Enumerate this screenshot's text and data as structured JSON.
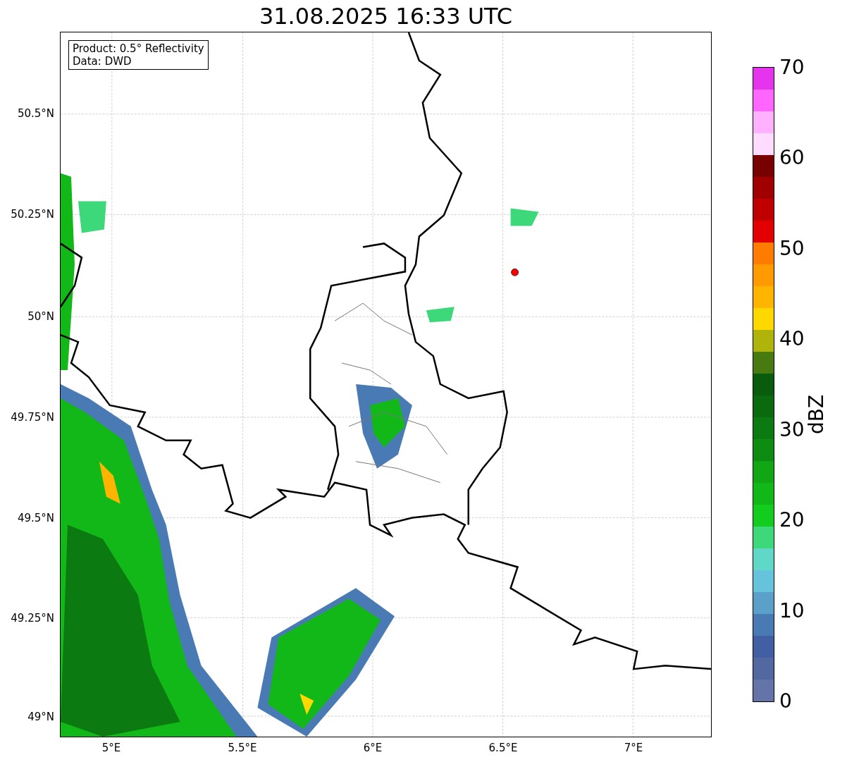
{
  "title": "31.08.2025 16:33 UTC",
  "info_box": [
    "Product: 0.5° Reflectivity",
    "Data: DWD"
  ],
  "y_ticks": [
    "50.5°N",
    "50.25°N",
    "50°N",
    "49.75°N",
    "49.5°N",
    "49.25°N",
    "49°N"
  ],
  "x_ticks": [
    "5°E",
    "5.5°E",
    "6°E",
    "6.5°E",
    "7°E"
  ],
  "colorbar": {
    "label": "dBZ",
    "ticks": [
      "70",
      "60",
      "50",
      "40",
      "30",
      "20",
      "10",
      "0"
    ],
    "bands": [
      {
        "color": "#e633ee"
      },
      {
        "color": "#ff66ff"
      },
      {
        "color": "#ffb0ff"
      },
      {
        "color": "#ffdcff"
      },
      {
        "color": "#780000"
      },
      {
        "color": "#a00000"
      },
      {
        "color": "#c00000"
      },
      {
        "color": "#e20000"
      },
      {
        "color": "#ff7c00"
      },
      {
        "color": "#ff9a00"
      },
      {
        "color": "#ffb400"
      },
      {
        "color": "#ffd800"
      },
      {
        "color": "#b0b40a"
      },
      {
        "color": "#477a10"
      },
      {
        "color": "#085c0c"
      },
      {
        "color": "#0a6a0e"
      },
      {
        "color": "#0b7a10"
      },
      {
        "color": "#0e8c12"
      },
      {
        "color": "#10a614"
      },
      {
        "color": "#12b818"
      },
      {
        "color": "#12cc1e"
      },
      {
        "color": "#3dd87a"
      },
      {
        "color": "#60d8c8"
      },
      {
        "color": "#65c3dc"
      },
      {
        "color": "#5aa0c8"
      },
      {
        "color": "#4a7ab4"
      },
      {
        "color": "#435fa3"
      },
      {
        "color": "#5268a0"
      },
      {
        "color": "#6474a8"
      }
    ]
  }
}
